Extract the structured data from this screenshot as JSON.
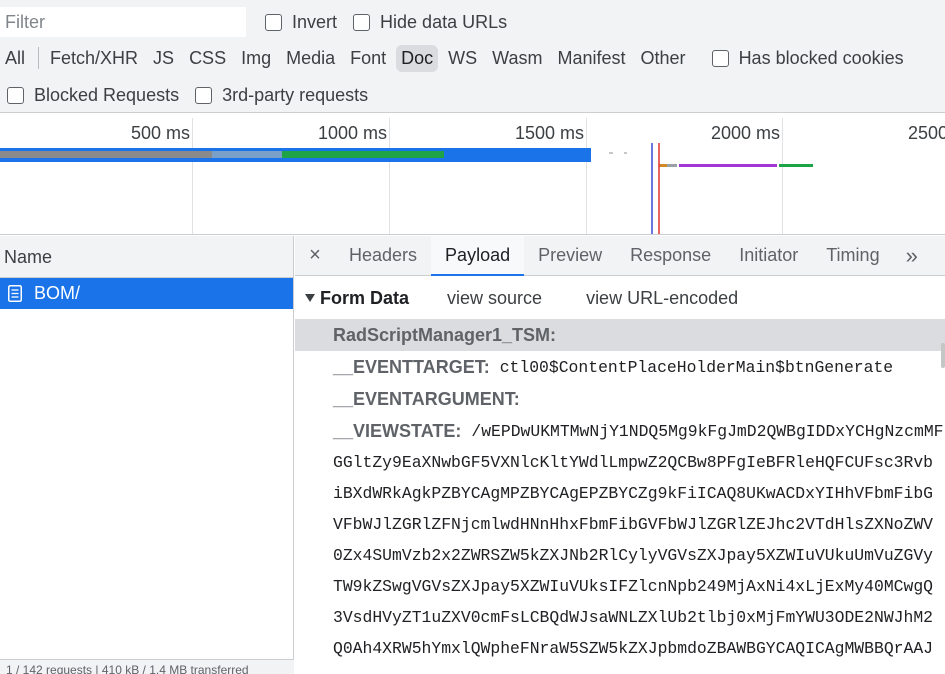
{
  "filter": {
    "placeholder": "Filter",
    "value": ""
  },
  "toolbar": {
    "invert_label": "Invert",
    "hide_data_urls_label": "Hide data URLs",
    "types": [
      "All",
      "Fetch/XHR",
      "JS",
      "CSS",
      "Img",
      "Media",
      "Font",
      "Doc",
      "WS",
      "Wasm",
      "Manifest",
      "Other"
    ],
    "active_type": "Doc",
    "has_blocked_cookies_label": "Has blocked cookies",
    "blocked_requests_label": "Blocked Requests",
    "third_party_label": "3rd-party requests"
  },
  "overview": {
    "ticks": [
      "500 ms",
      "1000 ms",
      "1500 ms",
      "2000 ms",
      "2500"
    ]
  },
  "request_list": {
    "header": "Name",
    "rows": [
      {
        "name": "BOM/",
        "icon": "document-icon"
      }
    ],
    "status": "1 / 142 requests   |   410 kB / 1.4 MB transferred"
  },
  "detail": {
    "close_label": "×",
    "tabs": [
      "Headers",
      "Payload",
      "Preview",
      "Response",
      "Initiator",
      "Timing"
    ],
    "active_tab": "Payload",
    "more_label": "»",
    "section_title": "Form Data",
    "view_source": "view source",
    "view_url_encoded": "view URL-encoded",
    "fields": [
      {
        "key": "RadScriptManager1_TSM:",
        "value": ""
      },
      {
        "key": "__EVENTTARGET:",
        "value": "ctl00$ContentPlaceHolderMain$btnGenerate"
      },
      {
        "key": "__EVENTARGUMENT:",
        "value": ""
      },
      {
        "key": "__VIEWSTATE:",
        "value": "/wEPDwUKMTMwNjY1NDQ5Mg9kFgJmD2QWBgIDDxYCHgNzcmMF"
      }
    ],
    "viewstate_lines": [
      "GGltZy9EaXNwbGF5VXNlcKltYWdlLmpwZ2QCBw8PFgIeBFRleHQFCUFsc3Rvb",
      "iBXdWRkAgkPZBYCAgMPZBYCAgEPZBYCZg9kFiICAQ8UKwACDxYIHhVFbmFibG",
      "VFbWJlZGRlZFNjcmlwdHNnHhxFbmFibGVFbWJlZGRlZEJhc2VTdHlsZXNoZWV",
      "0Zx4SUmVzb2x2ZWRSZW5kZXJNb2RlCylyVGVsZXJpay5XZWIuVUkuUmVuZGVy",
      "TW9kZSwgVGVsZXJpay5XZWIuVUksIFZlcnNpb249MjAxNi4xLjExMy40MCwgQ",
      "3VsdHVyZT1uZXV0cmFsLCBQdWJsaWNLZXlUb2tlbj0xMjFmYWU3ODE2NWJhM2",
      "Q0Ah4XRW5hYmxlQWpheFNraW5SZW5kZXJpbmdoZBAWBGYCAQICAgMWBBQrAAJ"
    ]
  },
  "colors": {
    "accent": "#1a73e8",
    "selected_row": "#1a73e8",
    "toolbar_bg": "#f1f3f4"
  }
}
